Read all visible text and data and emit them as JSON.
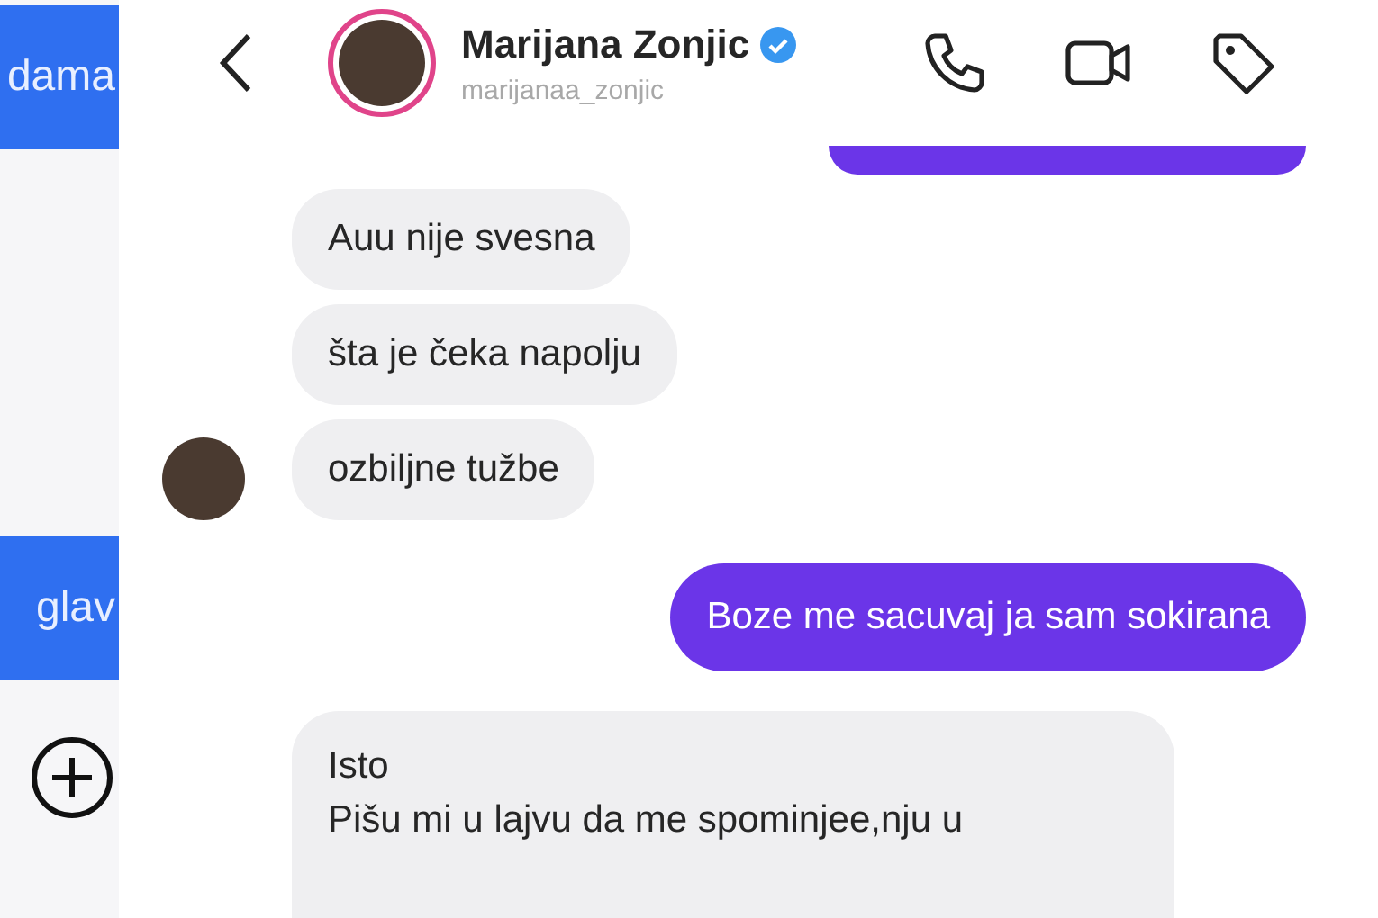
{
  "side_panel": {
    "bubbles": [
      "dama",
      "glav"
    ]
  },
  "header": {
    "name": "Marijana Zonjic",
    "verified": true,
    "username": "marijanaa_zonjic"
  },
  "messages": [
    {
      "kind": "partial_sent"
    },
    {
      "kind": "received",
      "text": "Auu nije svesna",
      "show_avatar": false
    },
    {
      "kind": "received",
      "text": "šta je čeka napolju",
      "show_avatar": false
    },
    {
      "kind": "received",
      "text": "ozbiljne tužbe",
      "show_avatar": true
    },
    {
      "kind": "sent",
      "text": "Boze me sacuvaj ja sam sokirana"
    },
    {
      "kind": "received_multi",
      "lines": [
        "Isto",
        "Pišu mi u lajvu da me spominjee,nju u"
      ],
      "show_avatar": false
    }
  ]
}
